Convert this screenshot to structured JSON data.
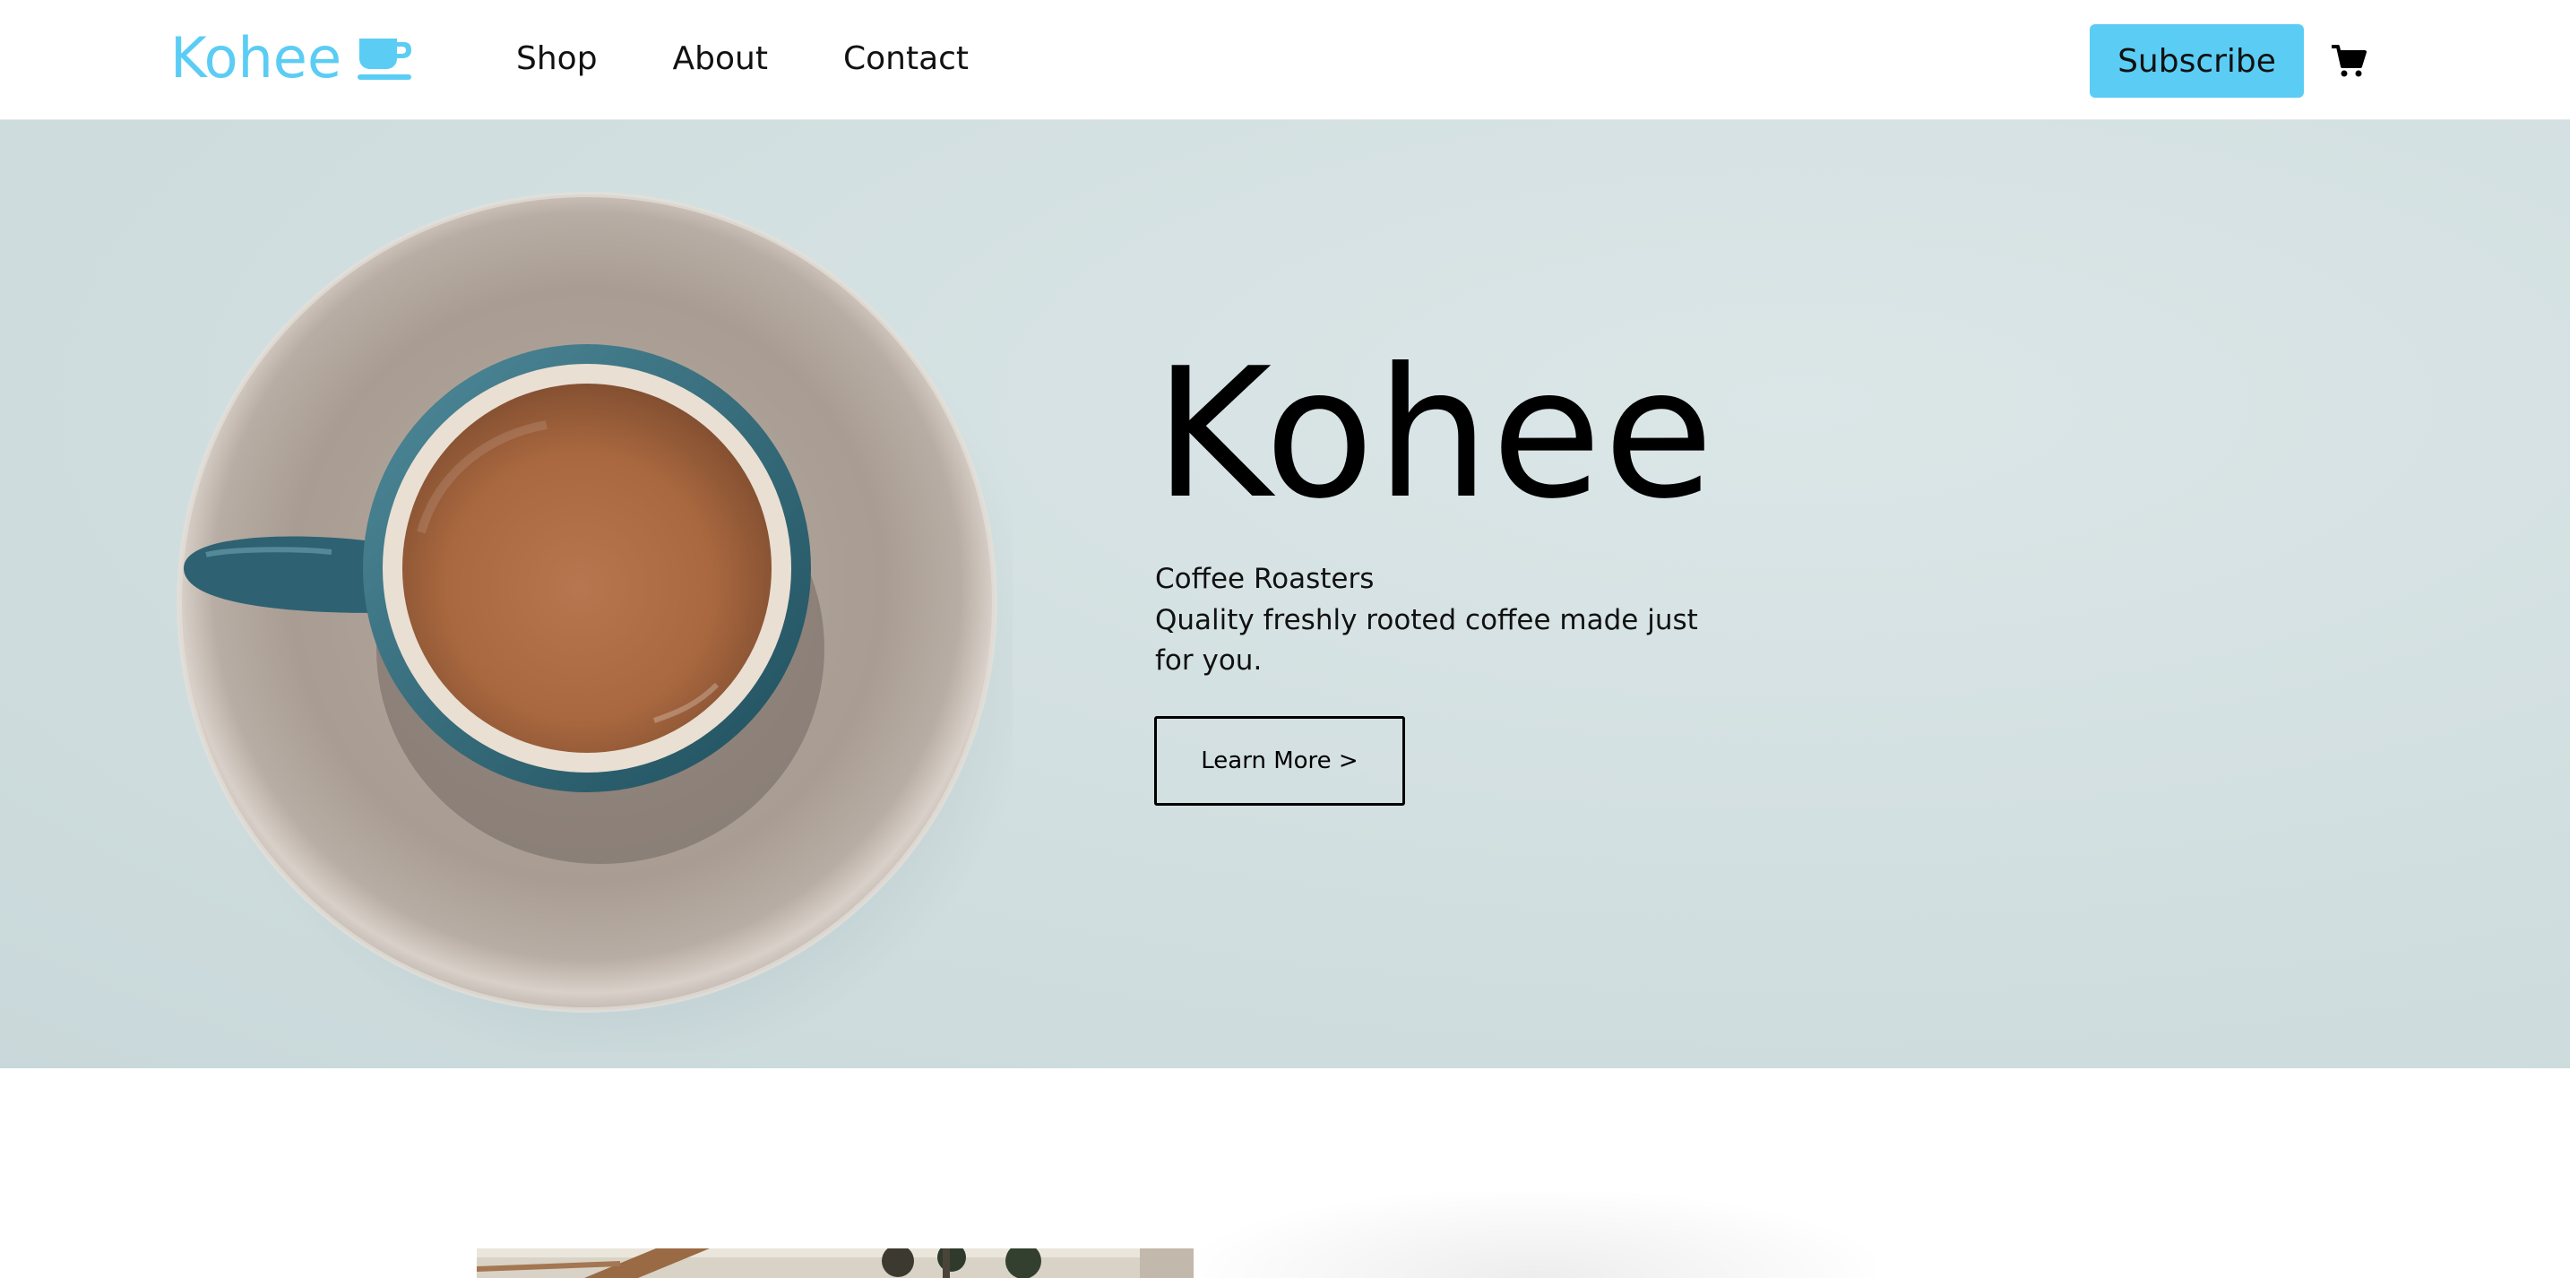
{
  "header": {
    "logo_text": "Kohee",
    "logo_icon": "coffee-cup-icon",
    "nav": [
      {
        "label": "Shop"
      },
      {
        "label": "About"
      },
      {
        "label": "Contact"
      }
    ],
    "subscribe_label": "Subscribe",
    "cart_icon": "shopping-cart-icon"
  },
  "hero": {
    "title": "Kohee",
    "subtitle": "Coffee Roasters",
    "description": "Quality freshly rooted coffee made just for you.",
    "cta_label": "Learn More >",
    "image_icon": "coffee-cup-photo"
  },
  "colors": {
    "accent": "#5bcdf4",
    "hero_background": "#d3e0e1",
    "text": "#111111"
  }
}
